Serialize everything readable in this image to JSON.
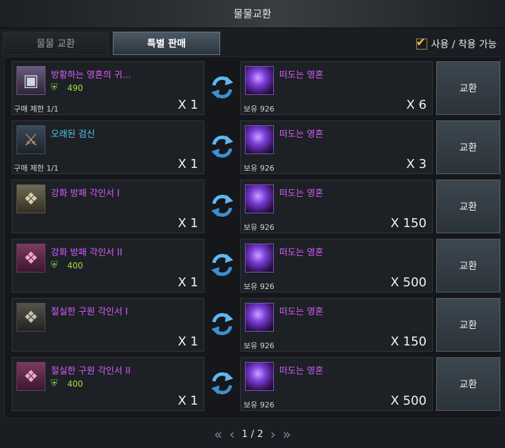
{
  "window": {
    "title": "물물교환"
  },
  "tabs": [
    {
      "label": "물물 교환",
      "active": false
    },
    {
      "label": "특별 판매",
      "active": true
    }
  ],
  "filter": {
    "label": "사용 / 착용 가능",
    "checked": true
  },
  "rows": [
    {
      "input": {
        "name": "방황하는 영혼의 귀...",
        "name_color": "#d85cff",
        "icon": "chest-icon",
        "level": "490",
        "limit": "구매 제한 1/1",
        "qty": "X 1"
      },
      "output": {
        "name": "떠도는 영혼",
        "icon": "soul-orb-icon",
        "have": "보유 926",
        "qty": "X 6"
      },
      "button": "교환"
    },
    {
      "input": {
        "name": "오래된 검신",
        "name_color": "#57c7f0",
        "icon": "sword-icon",
        "level": "",
        "limit": "구매 제한 1/1",
        "qty": "X 1"
      },
      "output": {
        "name": "떠도는 영혼",
        "icon": "soul-orb-icon",
        "have": "보유 926",
        "qty": "X 3"
      },
      "button": "교환"
    },
    {
      "input": {
        "name": "강화 방패 각인서 I",
        "name_color": "#d85cff",
        "icon": "book-icon",
        "level": "",
        "limit": "",
        "qty": "X 1"
      },
      "output": {
        "name": "떠도는 영혼",
        "icon": "soul-orb-icon",
        "have": "보유 926",
        "qty": "X 150"
      },
      "button": "교환"
    },
    {
      "input": {
        "name": "강화 방패 각인서 II",
        "name_color": "#d85cff",
        "icon": "book-icon",
        "level": "400",
        "limit": "",
        "qty": "X 1"
      },
      "output": {
        "name": "떠도는 영혼",
        "icon": "soul-orb-icon",
        "have": "보유 926",
        "qty": "X 500"
      },
      "button": "교환"
    },
    {
      "input": {
        "name": "절실한 구원 각인서 I",
        "name_color": "#d85cff",
        "icon": "book-icon",
        "level": "",
        "limit": "",
        "qty": "X 1"
      },
      "output": {
        "name": "떠도는 영혼",
        "icon": "soul-orb-icon",
        "have": "보유 926",
        "qty": "X 150"
      },
      "button": "교환"
    },
    {
      "input": {
        "name": "절실한 구원 각인서 II",
        "name_color": "#d85cff",
        "icon": "book-icon",
        "level": "400",
        "limit": "",
        "qty": "X 1"
      },
      "output": {
        "name": "떠도는 영혼",
        "icon": "soul-orb-icon",
        "have": "보유 926",
        "qty": "X 500"
      },
      "button": "교환"
    }
  ],
  "pager": {
    "text": "1 / 2"
  }
}
